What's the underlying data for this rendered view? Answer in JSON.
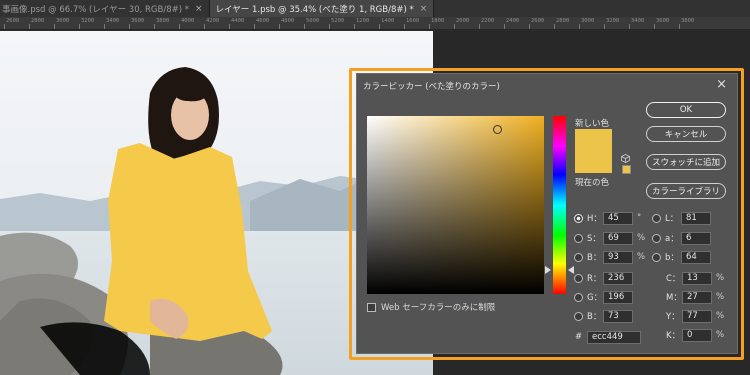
{
  "tabs": [
    {
      "label": "事画像.psd @ 66.7% (レイヤー 30, RGB/8#) *",
      "close": "×"
    },
    {
      "label": "レイヤー 1.psb @ 35.4% (べた塗り 1, RGB/8#) *",
      "close": "×"
    }
  ],
  "ruler_ticks": [
    "2600",
    "2800",
    "3000",
    "3200",
    "3400",
    "3600",
    "3800",
    "4000",
    "4200",
    "4400",
    "4600",
    "4800",
    "5000",
    "5200",
    "1200",
    "1400",
    "1600",
    "1800",
    "2000",
    "2200",
    "2400",
    "2600",
    "2800",
    "3000",
    "3200",
    "3400",
    "3600",
    "3800"
  ],
  "dialog": {
    "title": "カラーピッカー (べた塗りのカラー)",
    "close": "×",
    "new_label": "新しい色",
    "current_label": "現在の色",
    "web_only_label": "Web セーフカラーのみに制限",
    "buttons": {
      "ok": "OK",
      "cancel": "キャンセル",
      "add_swatch": "スウォッチに追加",
      "color_library": "カラーライブラリ"
    },
    "hsb": [
      {
        "label": "H：",
        "value": "45",
        "unit": "°",
        "selected": true
      },
      {
        "label": "S：",
        "value": "69",
        "unit": "%",
        "selected": false
      },
      {
        "label": "B：",
        "value": "93",
        "unit": "%",
        "selected": false
      }
    ],
    "rgb": [
      {
        "label": "R：",
        "value": "236"
      },
      {
        "label": "G：",
        "value": "196"
      },
      {
        "label": "B：",
        "value": "73"
      }
    ],
    "lab": [
      {
        "label": "L：",
        "value": "81"
      },
      {
        "label": "a：",
        "value": "6"
      },
      {
        "label": "b：",
        "value": "64"
      }
    ],
    "cmyk": [
      {
        "label": "C：",
        "value": "13",
        "unit": "%"
      },
      {
        "label": "M：",
        "value": "27",
        "unit": "%"
      },
      {
        "label": "Y：",
        "value": "77",
        "unit": "%"
      },
      {
        "label": "K：",
        "value": "0",
        "unit": "%"
      }
    ],
    "hex_label": "#",
    "hex_value": "ecc449"
  },
  "colors": {
    "selected_color": "#ecc449",
    "highlight": "#f5a020"
  }
}
